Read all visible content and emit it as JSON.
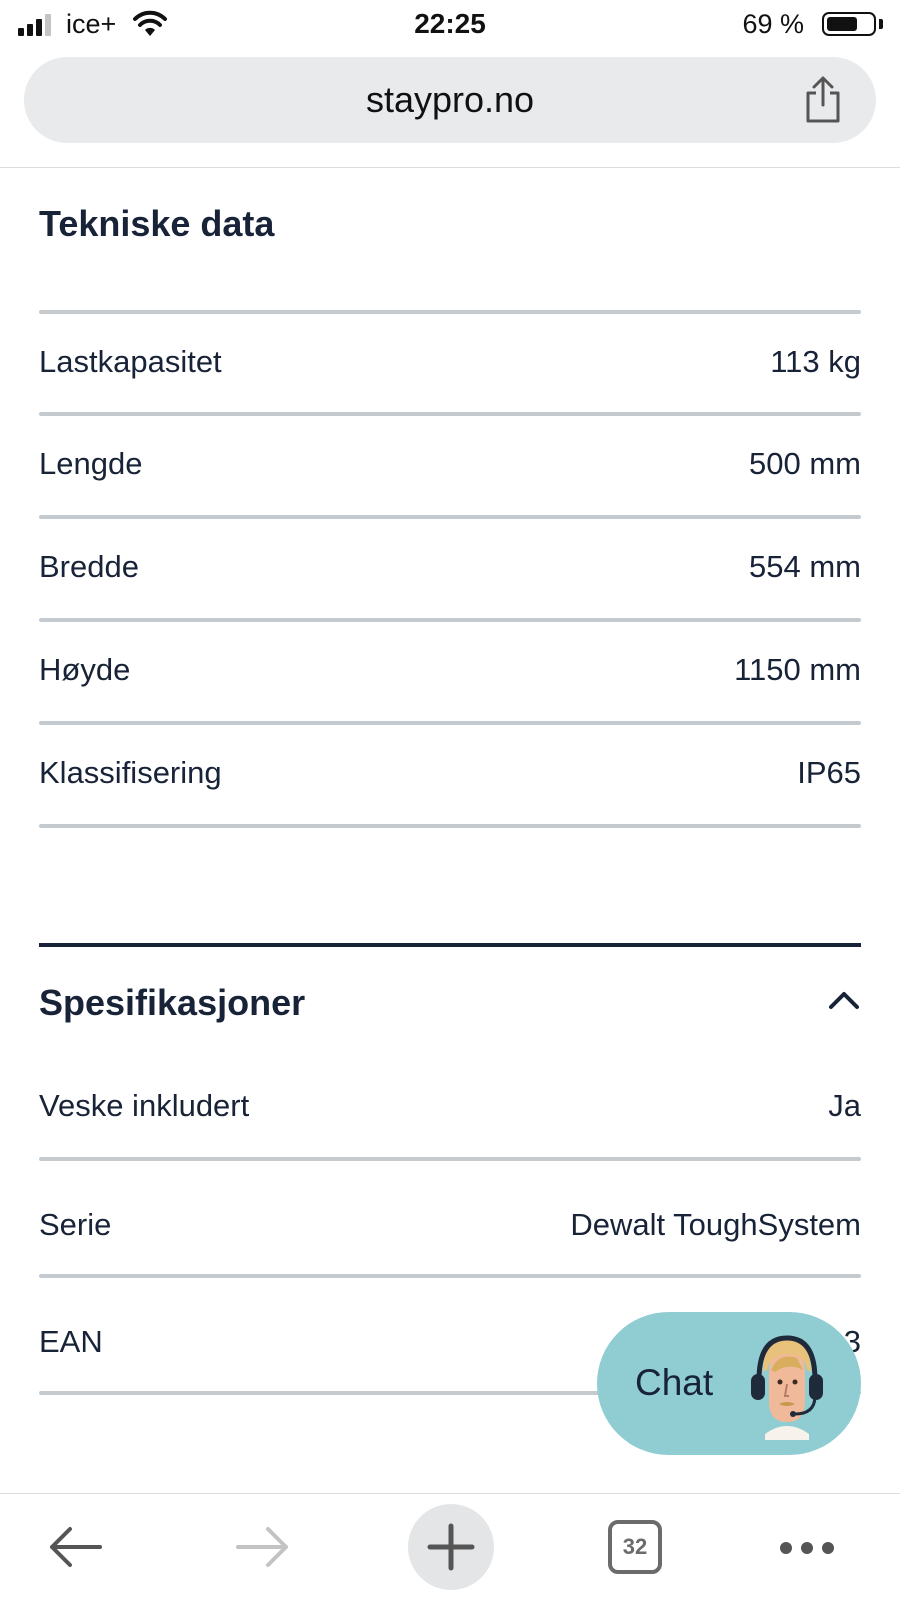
{
  "status_bar": {
    "carrier": "ice+",
    "time": "22:25",
    "battery_percent": "69 %",
    "battery_level": 0.69
  },
  "browser": {
    "url": "staypro.no",
    "tab_count": "32"
  },
  "technical_data": {
    "title": "Tekniske data",
    "rows": [
      {
        "label": "Lastkapasitet",
        "value": "113 kg"
      },
      {
        "label": "Lengde",
        "value": "500 mm"
      },
      {
        "label": "Bredde",
        "value": "554 mm"
      },
      {
        "label": "Høyde",
        "value": "1150 mm"
      },
      {
        "label": "Klassifisering",
        "value": "IP65"
      }
    ]
  },
  "specifications": {
    "title": "Spesifikasjoner",
    "rows": [
      {
        "label": "Veske inkludert",
        "value": "Ja"
      },
      {
        "label": "Serie",
        "value": "Dewalt ToughSystem"
      },
      {
        "label": "EAN",
        "value": "3"
      }
    ]
  },
  "chat": {
    "label": "Chat"
  },
  "colors": {
    "text": "#182338",
    "chat_bg": "#8fcdd2",
    "divider": "#c5cace"
  }
}
